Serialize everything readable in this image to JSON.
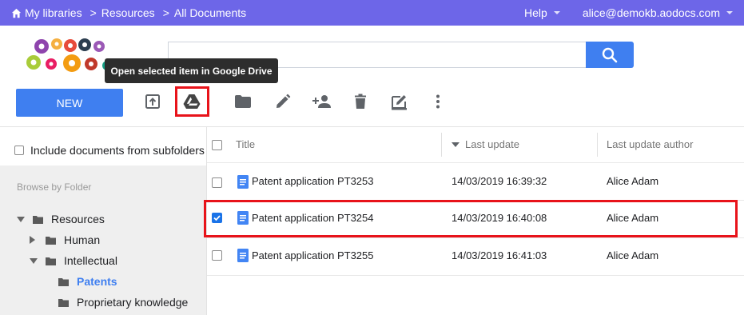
{
  "topbar": {
    "breadcrumbs": [
      "My libraries",
      "Resources",
      "All Documents"
    ],
    "separator": ">",
    "help_label": "Help",
    "user_email": "alice@demokb.aodocs.com",
    "bg_color": "#6d66e8"
  },
  "search": {
    "value": "",
    "placeholder": "",
    "button_icon": "search-icon"
  },
  "tooltip": {
    "text": "Open selected item in Google Drive"
  },
  "toolbar": {
    "new_label": "NEW",
    "tools": [
      "open-in-new-icon",
      "google-drive-icon",
      "folder-icon",
      "edit-icon",
      "add-person-icon",
      "delete-icon",
      "edit-properties-icon",
      "more-vert-icon"
    ]
  },
  "sidebar": {
    "include_subfolders_label": "Include documents from subfolders",
    "browse_label": "Browse by Folder",
    "tree": [
      {
        "label": "Resources",
        "expanded": true
      },
      {
        "label": "Human",
        "expanded": false
      },
      {
        "label": "Intellectual",
        "expanded": true
      },
      {
        "label": "Patents",
        "active": true
      },
      {
        "label": "Proprietary knowledge"
      }
    ]
  },
  "table": {
    "columns": [
      "Title",
      "Last update",
      "Last update author"
    ],
    "sort_column": "Last update",
    "rows": [
      {
        "title": "Patent application PT3253",
        "last_update": "14/03/2019 16:39:32",
        "author": "Alice Adam",
        "checked": false
      },
      {
        "title": "Patent application PT3254",
        "last_update": "14/03/2019 16:40:08",
        "author": "Alice Adam",
        "checked": true
      },
      {
        "title": "Patent application PT3255",
        "last_update": "14/03/2019 16:41:03",
        "author": "Alice Adam",
        "checked": false
      }
    ]
  },
  "colors": {
    "accent": "#3f7ff0",
    "highlight": "#e8131a",
    "doc_icon": "#4285f4"
  }
}
